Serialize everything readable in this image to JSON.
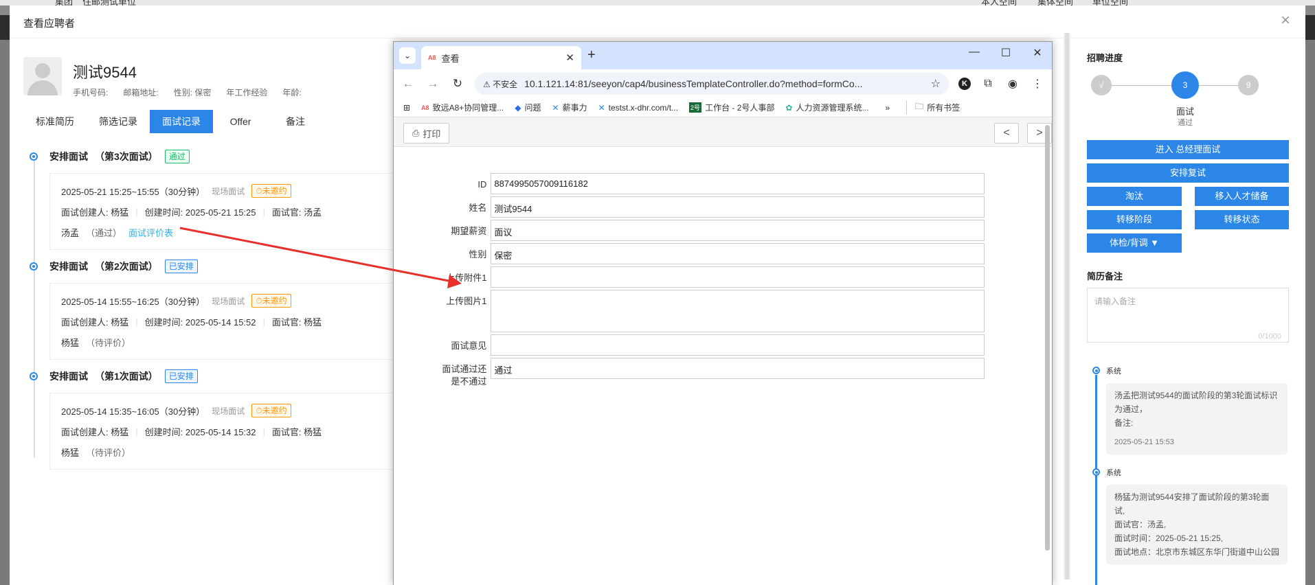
{
  "background": {
    "top_items": [
      "集团",
      "住邮测试单位",
      "本人空间",
      "集体空间",
      "单位空间"
    ]
  },
  "dialog": {
    "title": "查看应聘者",
    "close": "×"
  },
  "candidate": {
    "name": "测试9544",
    "meta": [
      "手机号码:",
      "邮箱地址:",
      "性别: 保密",
      "年工作经验",
      "年龄:"
    ]
  },
  "tabs": [
    "标准简历",
    "筛选记录",
    "面试记录",
    "Offer",
    "备注"
  ],
  "interviews": [
    {
      "title": "安排面试",
      "round": "（第3次面试）",
      "badge": "通过",
      "time": "2025-05-21 15:25~15:55（30分钟）",
      "type": "现场面试",
      "invite": "⏱未邀约",
      "creator": "面试创建人: 杨猛",
      "created": "创建时间: 2025-05-21 15:25",
      "interviewer": "面试官: 汤孟",
      "result_name": "汤孟",
      "result": "（通过）",
      "link": "面试评价表"
    },
    {
      "title": "安排面试",
      "round": "（第2次面试）",
      "badge": "已安排",
      "time": "2025-05-14 15:55~16:25（30分钟）",
      "type": "现场面试",
      "invite": "⏱未邀约",
      "creator": "面试创建人: 杨猛",
      "created": "创建时间: 2025-05-14 15:52",
      "interviewer": "面试官: 杨猛",
      "result_name": "杨猛",
      "result": "（待评价）",
      "link": ""
    },
    {
      "title": "安排面试",
      "round": "（第1次面试）",
      "badge": "已安排",
      "time": "2025-05-14 15:35~16:05（30分钟）",
      "type": "现场面试",
      "invite": "⏱未邀约",
      "creator": "面试创建人: 杨猛",
      "created": "创建时间: 2025-05-14 15:32",
      "interviewer": "面试官: 杨猛",
      "result_name": "杨猛",
      "result": "（待评价）",
      "link": ""
    }
  ],
  "browser": {
    "tab_title": "查看",
    "tab_favicon": "A8",
    "new_tab": "+",
    "insecure": "⚠ 不安全",
    "url": "10.1.121.14:81/seeyon/cap4/businessTemplateController.do?method=formCo...",
    "bookmarks": [
      {
        "icon": "A8",
        "label": "致远A8+协同管理..."
      },
      {
        "icon": "◆",
        "label": "问题"
      },
      {
        "icon": "✕",
        "label": "薪事力"
      },
      {
        "icon": "✕",
        "label": "testst.x-dhr.com/t..."
      },
      {
        "icon": "2号",
        "label": "工作台 - 2号人事部"
      },
      {
        "icon": "✿",
        "label": "人力资源管理系统..."
      }
    ],
    "bookmarks_more": "»",
    "all_bookmarks": "所有书签",
    "print": "打印",
    "prev": "<",
    "next": ">"
  },
  "form": {
    "fields": [
      {
        "label": "ID",
        "value": "8874995057009116182",
        "tall": false
      },
      {
        "label": "姓名",
        "value": "测试9544",
        "tall": false
      },
      {
        "label": "期望薪资",
        "value": "面议",
        "tall": false
      },
      {
        "label": "性别",
        "value": "保密",
        "tall": false
      },
      {
        "label": "上传附件1",
        "value": "",
        "tall": false
      },
      {
        "label": "上传图片1",
        "value": "",
        "tall": true
      },
      {
        "label": "面试意见",
        "value": "",
        "tall": false
      },
      {
        "label": "面试通过还是不通过",
        "value": "通过",
        "tall": false
      }
    ]
  },
  "progress": {
    "title": "招聘进度",
    "step_done": "√",
    "step_current": "3",
    "step_next": "9",
    "current_label": "面试",
    "current_status": "通过"
  },
  "actions": {
    "enter_gm": "进入 总经理面试",
    "rearrange": "安排复试",
    "eliminate": "淘汰",
    "move_talent": "移入人才储备",
    "move_stage": "转移阶段",
    "move_status": "转移状态",
    "background_check": "体检/背调 ▼"
  },
  "notes": {
    "title": "简历备注",
    "placeholder": "请输入备注",
    "counter": "0/1000"
  },
  "logs": [
    {
      "source": "系统",
      "lines": [
        "汤孟把测试9544的面试阶段的第3轮面试标识为通过，",
        "备注:"
      ],
      "time": "2025-05-21 15:53"
    },
    {
      "source": "系统",
      "lines": [
        "杨猛为测试9544安排了面试阶段的第3轮面试,",
        "面试官：汤孟,",
        "面试时间：2025-05-21 15:25,",
        "面试地点：北京市东城区东华门街道中山公园"
      ],
      "time": ""
    }
  ],
  "colors": {
    "primary": "#2b86e8",
    "pass": "#19be6b",
    "warning": "#ff9900",
    "arrow": "#e8302a"
  }
}
